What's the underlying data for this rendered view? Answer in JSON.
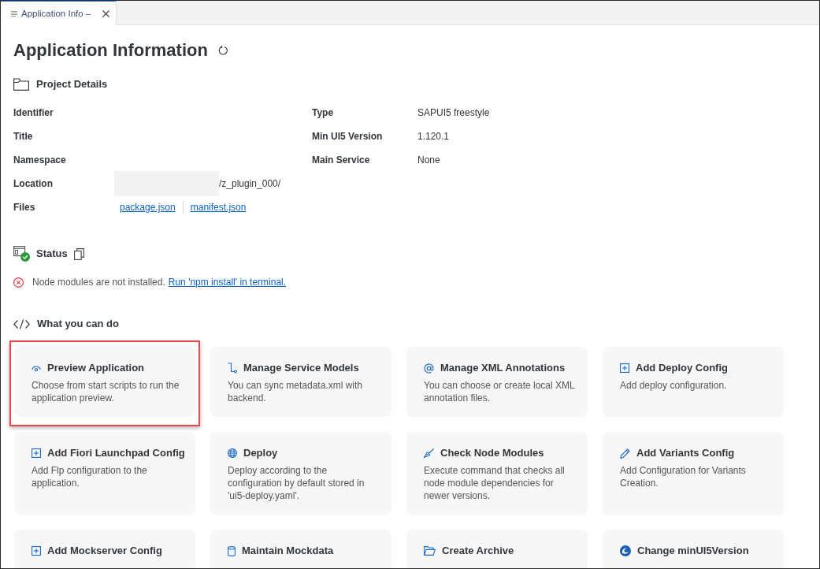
{
  "tabs": [
    {
      "label": "Application Info –",
      "selected": true
    }
  ],
  "page": {
    "title": "Application Information"
  },
  "project_details": {
    "heading": "Project Details",
    "left_fields": [
      {
        "label": "Identifier"
      },
      {
        "label": "Title"
      },
      {
        "label": "Namespace"
      },
      {
        "label": "Location",
        "value": "/z_plugin_000/",
        "redacted": true
      },
      {
        "label": "Files",
        "links": [
          "package.json",
          "manifest.json"
        ]
      }
    ],
    "right_fields": [
      {
        "label": "Type",
        "value": "SAPUI5 freestyle"
      },
      {
        "label": "Min UI5 Version",
        "value": "1.120.1"
      },
      {
        "label": "Main Service",
        "value": "None"
      }
    ]
  },
  "status": {
    "heading": "Status",
    "messages": [
      {
        "kind": "error",
        "text": "Node modules are not installed.",
        "link": "Run 'npm install' in terminal."
      }
    ]
  },
  "actions": {
    "heading": "What you can do",
    "cards": [
      {
        "title": "Preview Application",
        "description": "Choose from start scripts to run the application preview.",
        "highlighted": true
      },
      {
        "title": "Manage Service Models",
        "description": "You can sync metadata.xml with backend."
      },
      {
        "title": "Manage XML Annotations",
        "description": "You can choose or create local XML annotation files."
      },
      {
        "title": "Add Deploy Config",
        "description": "Add deploy configuration."
      },
      {
        "title": "Add Fiori Launchpad Config",
        "description": "Add Flp configuration to the application."
      },
      {
        "title": "Deploy",
        "description": "Deploy according to the configuration by default stored in 'ui5-deploy.yaml'."
      },
      {
        "title": "Check Node Modules",
        "description": "Execute command that checks all node module dependencies for newer versions."
      },
      {
        "title": "Add Variants Config",
        "description": "Add Configuration for Variants Creation."
      },
      {
        "title": "Add Mockserver Config"
      },
      {
        "title": "Maintain Mockdata"
      },
      {
        "title": "Create Archive"
      },
      {
        "title": "Change minUI5Version"
      }
    ]
  }
}
